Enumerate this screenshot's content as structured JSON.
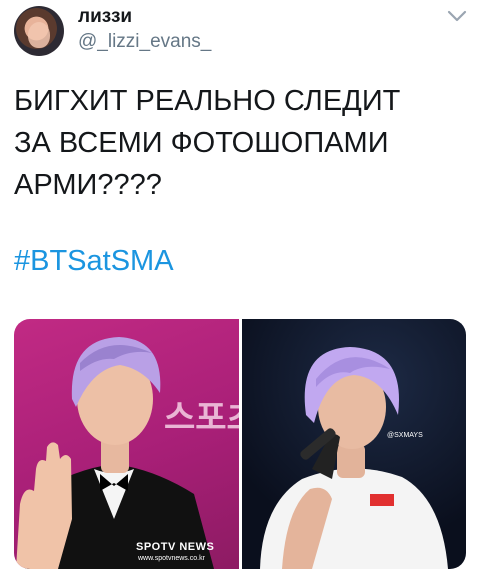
{
  "author": {
    "name": "лиззи",
    "handle": "@_lizzi_evans_"
  },
  "tweet": {
    "text": "БИГХИТ РЕАЛЬНО СЛЕДИТ\nЗА ВСЕМИ ФОТОШОПАМИ\nАРМИ????",
    "hashtag": "#BTSatSMA"
  },
  "media": {
    "photo_left": {
      "watermark": "SPOTV NEWS",
      "watermark_url": "www.spotvnews.co.kr",
      "backdrop_text": "스포츠"
    },
    "photo_right": {
      "watermark": "@SXMAYS"
    }
  },
  "colors": {
    "text": "#14171a",
    "muted": "#657786",
    "link": "#1b95e0",
    "hair": "#b9a0e6"
  },
  "icons": {
    "menu": "chevron-down-icon"
  }
}
